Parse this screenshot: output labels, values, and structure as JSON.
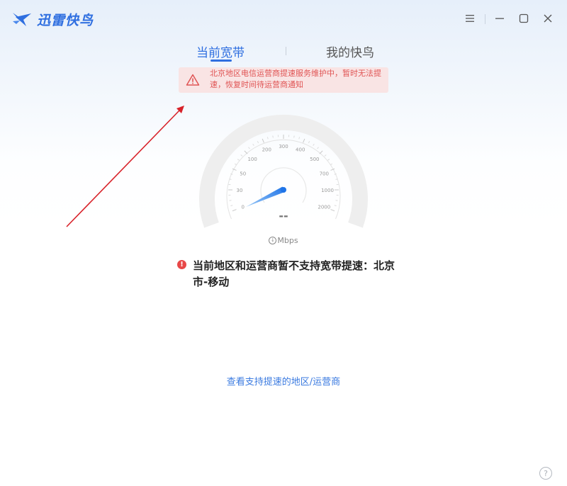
{
  "app": {
    "name": "迅雷快鸟",
    "brand_color": "#2f6fe0"
  },
  "title_bar": {
    "menu_icon": "hamburger-menu-icon",
    "minimize_icon": "minimize-icon",
    "maximize_icon": "maximize-icon",
    "close_icon": "close-icon"
  },
  "tabs": [
    {
      "label": "当前宽带",
      "active": true
    },
    {
      "label": "我的快鸟",
      "active": false
    }
  ],
  "banner": {
    "icon": "warning-triangle-icon",
    "text": "北京地区电信运营商提速服务维护中，暂时无法提速，恢复时间待运营商通知",
    "text_color": "#e05454",
    "background": "#f9e4e4"
  },
  "gauge": {
    "tick_labels": [
      "0",
      "30",
      "50",
      "100",
      "200",
      "300",
      "400",
      "500",
      "700",
      "1000",
      "2000"
    ],
    "speed_value": "--",
    "unit": "Mbps",
    "unit_icon": "download-arrow-icon",
    "accent_color": "#2f80ed"
  },
  "error": {
    "icon": "error-circle-icon",
    "text": "当前地区和运营商暂不支持宽带提速：北京市-移动",
    "icon_color": "#e84848"
  },
  "support_link": "查看支持提速的地区/运营商",
  "help_icon": "help-question-icon"
}
